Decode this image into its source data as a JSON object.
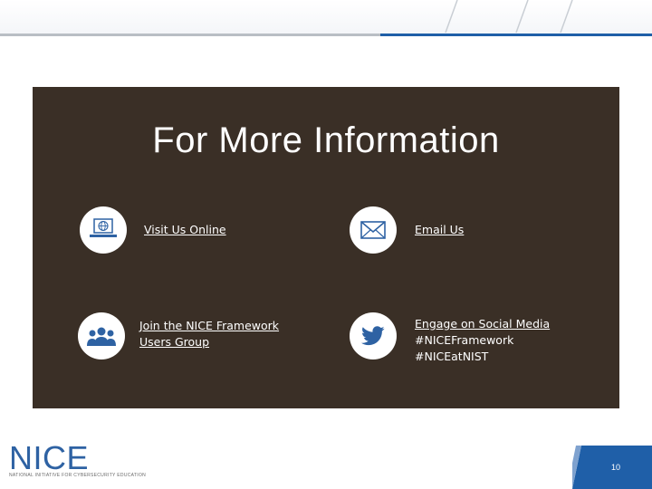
{
  "slide": {
    "title": "For More Information",
    "items": {
      "visit_online": {
        "label": "Visit Us Online",
        "icon": "laptop-globe-icon"
      },
      "email": {
        "label": "Email Us",
        "icon": "envelope-icon"
      },
      "join_group": {
        "line1": "Join the NICE Framework",
        "line2": "Users Group",
        "icon": "people-group-icon"
      },
      "social": {
        "label": "Engage on Social Media",
        "hashtags": [
          "#NICEFramework",
          "#NICEatNIST"
        ],
        "icon": "twitter-bird-icon"
      }
    }
  },
  "footer": {
    "logo_text": "NICE",
    "logo_tagline": "NATIONAL INITIATIVE FOR CYBERSECURITY EDUCATION",
    "page_number": "10"
  },
  "colors": {
    "card_background": "#3a2f26",
    "brand_blue": "#2e62a3",
    "accent_blue": "#1f5fa8",
    "text_on_card": "#ffffff"
  }
}
